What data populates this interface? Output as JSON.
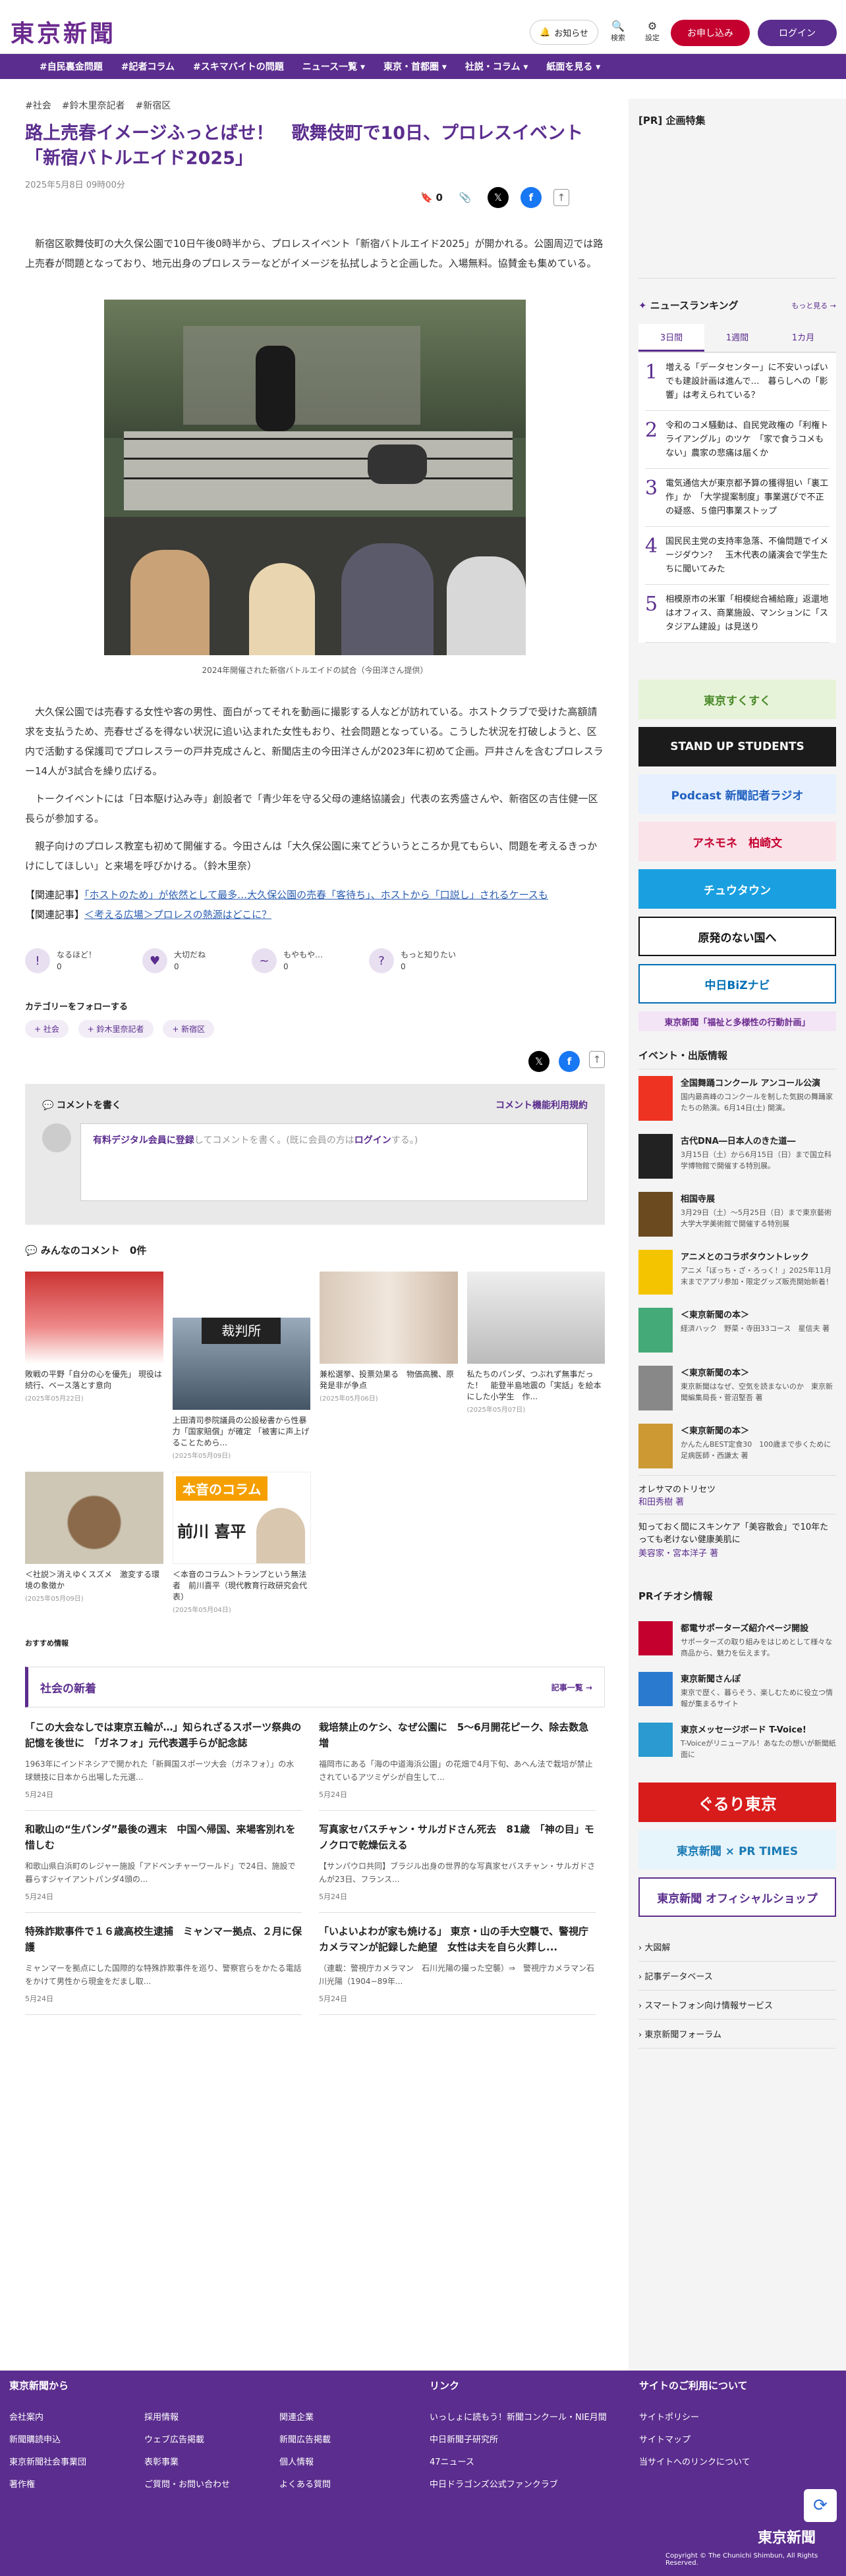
{
  "header": {
    "logo": "東京新聞",
    "notif": "お知らせ",
    "search": "検索",
    "settings": "設定",
    "register": "お申し込み",
    "login": "ログイン"
  },
  "nav": [
    "#自民裏金問題",
    "#記者コラム",
    "#スキマバイトの問題",
    "ニュース一覧 ▾",
    "東京・首都圏 ▾",
    "社説・コラム ▾",
    "紙面を見る ▾"
  ],
  "article": {
    "tags": [
      "#社会",
      "#鈴木里奈記者",
      "#新宿区"
    ],
    "title": "路上売春イメージふっとばせ！　歌舞伎町で10日、プロレスイベント「新宿バトルエイド2025」",
    "date": "2025年5月8日 09時00分",
    "bookmark_count": "0",
    "p1": "新宿区歌舞伎町の大久保公園で10日午後0時半から、プロレスイベント「新宿バトルエイド2025」が開かれる。公園周辺では路上売春が問題となっており、地元出身のプロレスラーなどがイメージを払拭しようと企画した。入場無料。協賛金も集めている。",
    "caption": "2024年開催された新宿バトルエイドの試合（今田洋さん提供）",
    "p2": "大久保公園では売春する女性や客の男性、面白がってそれを動画に撮影する人などが訪れている。ホストクラブで受けた高額請求を支払うため、売春せざるを得ない状況に追い込まれた女性もおり、社会問題となっている。こうした状況を打破しようと、区内で活動する保護司でプロレスラーの戸井克成さんと、新聞店主の今田洋さんが2023年に初めて企画。戸井さんを含むプロレスラー14人が3試合を繰り広げる。",
    "p3": "トークイベントには「日本駆け込み寺」創設者で「青少年を守る父母の連絡協議会」代表の玄秀盛さんや、新宿区の吉住健一区長らが参加する。",
    "p4": "親子向けのプロレス教室も初めて開催する。今田さんは「大久保公園に来てどういうところか見てもらい、問題を考えるきっかけにしてほしい」と来場を呼びかける。（鈴木里奈）",
    "rel_label": "【関連記事】",
    "rel1": "「ホストのため」が依然として最多…大久保公園の売春「客待ち」、ホストから「口説し」されるケースも",
    "rel2": "＜考える広場＞プロレスの熱源はどこに？"
  },
  "reactions": [
    {
      "label": "なるほど！",
      "count": "0"
    },
    {
      "label": "大切だね",
      "count": "0"
    },
    {
      "label": "もやもや…",
      "count": "0"
    },
    {
      "label": "もっと知りたい",
      "count": "0"
    }
  ],
  "follow": {
    "title": "カテゴリーをフォローする",
    "chips": [
      "+ 社会",
      "+ 鈴木里奈記者",
      "+ 新宿区"
    ]
  },
  "comment": {
    "write": "コメントを書く",
    "rules": "コメント機能利用規約",
    "pre": "有料デジタル会員に登録",
    "mid": "してコメントを書く。(既に会員の方は",
    "login": "ログイン",
    "post": "する。)",
    "all": "みんなのコメント　0件"
  },
  "thumbs": [
    {
      "t": "敗戦の平野「自分の心を優先」 現役は続行、ベース落とす意向",
      "d": "(2025年05月22日)"
    },
    {
      "t": "上田清司参院議員の公設秘書から性暴力「国家賠償」が確定 「被害に声上げることためら...",
      "d": "(2025年05月09日)"
    },
    {
      "t": "兼松選挙、投票効果る　物価高騰、原発是非が争点",
      "d": "(2025年05月06日)"
    },
    {
      "t": "私たちのパンダ、つぶれず無事だった！　能登半島地震の「実話」を絵本にした小学生　作...",
      "d": "(2025年05月07日)"
    },
    {
      "t": "＜社説＞消えゆくスズメ　激変する環境の象徴か",
      "d": "(2025年05月09日)"
    },
    {
      "t": "＜本音のコラム＞トランプという無法者　前川喜平（現代教育行政研究会代表）",
      "d": "(2025年05月04日)"
    }
  ],
  "column_name": "前川 喜平",
  "column_badge": "本音の",
  "column_badge2": "コラム",
  "recommend": "おすすめ情報",
  "shakai": {
    "head": "社会の新着",
    "more": "記事一覧 →",
    "items": [
      {
        "h": "「この大会なしでは東京五輪が…」知られざるスポーツ祭典の記憶を後世に　「ガネフォ」元代表選手らが記念誌",
        "s": "1963年にインドネシアで開かれた「新興国スポーツ大会（ガネフォ）」の水球競技に日本から出場した元選...",
        "d": "5月24日"
      },
      {
        "h": "栽培禁止のケシ、なぜ公園に　5～6月開花ピーク、除去数急増",
        "s": "福岡市にある「海の中道海浜公園」の花畑で4月下旬、あへん法で栽培が禁止されているアツミゲシが自生して...",
        "d": "5月24日"
      },
      {
        "h": "和歌山の“生パンダ”最後の週末　中国へ帰国、来場客別れを惜しむ",
        "s": "和歌山県白浜町のレジャー施設「アドベンチャーワールド」で24日、施設で暮らすジャイアントパンダ4頭の...",
        "d": "5月24日"
      },
      {
        "h": "写真家セバスチャン・サルガドさん死去　81歳　「神の目」モノクロで乾燥伝える",
        "s": "【サンパウロ共同】ブラジル出身の世界的な写真家セバスチャン・サルガドさんが23日、フランス...",
        "d": "5月24日"
      },
      {
        "h": "特殊詐欺事件で１６歳高校生逮捕　ミャンマー拠点、２月に保護",
        "s": "ミャンマーを拠点にした国際的な特殊詐欺事件を巡り、警察官らをかたる電話をかけて男性から現金をだまし取...",
        "d": "5月24日"
      },
      {
        "h": "「いよいよわが家も焼ける」 東京・山の手大空襲で、警視庁カメラマンが記録した絶望　女性は夫を自ら火葬し...",
        "s": "（連載：警視庁カメラマン　石川光陽の撮った空襲）⇒　警視庁カメラマン石川光陽（1904−89年...",
        "d": "5月24日"
      }
    ]
  },
  "sidebar": {
    "pr": "[PR] 企画特集",
    "rank_title": "ニュースランキング",
    "rank_more": "もっと見る →",
    "rank_tabs": [
      "3日間",
      "1週間",
      "1カ月"
    ],
    "rank": [
      {
        "n": "1",
        "t": "増える「データセンター」に不安いっぱいでも建設計画は進んで…　暮らしへの「影響」は考えられている？"
      },
      {
        "n": "2",
        "t": "令和のコメ騒動は、自民党政権の「利権トライアングル」のツケ　「家で食うコメもない」農家の悲痛は届くか"
      },
      {
        "n": "3",
        "t": "電気通信大が東京都予算の獲得狙い「裏工作」か　「大学提案制度」事業選びで不正の疑惑、５億円事業ストップ"
      },
      {
        "n": "4",
        "t": "国民民主党の支持率急落、不倫問題でイメージダウン？　玉木代表の議演会で学生たちに聞いてみた"
      },
      {
        "n": "5",
        "t": "相模原市の米軍「相模総合補給廠」返還地はオフィス、商業施設、マンションに「スタジアム建設」は見送り"
      }
    ],
    "banners": [
      {
        "t": "東京すくすく",
        "bg": "#e7f3d9",
        "fg": "#4a8a2a"
      },
      {
        "t": "STAND UP STUDENTS",
        "bg": "#1b1b1b",
        "fg": "#fff"
      },
      {
        "t": "Podcast 新聞記者ラジオ",
        "bg": "#e6f0ff",
        "fg": "#1f5fbf"
      },
      {
        "t": "アネモネ　柏崎文",
        "bg": "#fbe3ea",
        "fg": "#c4002f"
      },
      {
        "t": "チュウタウン",
        "bg": "#1aa0e0",
        "fg": "#fff"
      },
      {
        "t": "原発のない国へ",
        "bg": "#fff",
        "fg": "#111"
      },
      {
        "t": "中日BiZナビ",
        "bg": "#fff",
        "fg": "#006fb5"
      },
      {
        "t": "東京新聞「福祉と多様性の行動計画」",
        "bg": "#f3e4f6",
        "fg": "#6b2a8f"
      }
    ],
    "events_title": "イベント・出版情報",
    "events": [
      {
        "h": "全国舞踊コンクール アンコール公演",
        "s": "国内最高峰のコンクールを制した気鋭の舞踊家たちの熱演。6月14日(土) 開演。",
        "c": "#e32"
      },
      {
        "h": "古代DNA―日本人のきた道―",
        "s": "3月15日（土）から6月15日（日）まで国立科学博物館で開催する特別展。",
        "c": "#222"
      },
      {
        "h": "相国寺展",
        "s": "3月29日（土）～5月25日（日）まで東京藝術大学大学美術館で開催する特別展",
        "c": "#6b4a20"
      },
      {
        "h": "アニメとのコラボタウントレック",
        "s": "アニメ「ぼっち・ざ・ろっく！」2025年11月末までアプリ参加・限定グッズ販売開始新着！",
        "c": "#f5c400"
      },
      {
        "h": "＜東京新聞の本＞",
        "s": "経済ハック　野菜・寺田33コース　星信夫 著",
        "c": "#4a7"
      },
      {
        "h": "＜東京新聞の本＞",
        "s": "東京新聞はなぜ、空気を読まないのか　東京新聞編集局長・菅沼堅吾 著",
        "c": "#888"
      },
      {
        "h": "＜東京新聞の本＞",
        "s": "かんたんBEST定食30　100歳まで歩くために　足病医師・西謙太 著",
        "c": "#c93"
      }
    ],
    "book1": "オレサマのトリセツ",
    "book1b": "和田秀樹 著",
    "book2": "知っておく間にスキンケア「美容散会」で10年たっても老けない健康美肌に",
    "book2b": "美容家・宮本洋子 著",
    "pr_title": "PRイチオシ情報",
    "pr_items": [
      {
        "h": "都電サポーターズ紹介ページ開設",
        "s": "サポーターズの取り組みをはじめとして様々な商品から、魅力を伝えます。",
        "c": "#c4002f"
      },
      {
        "h": "東京新聞さんぽ",
        "s": "東京で歴く、暮らそう、楽しむために役立つ情報が集まるサイト",
        "c": "#2a7bd0"
      },
      {
        "h": "東京メッセージボード T-Voice!",
        "s": "T-Voiceがリニューアル！あなたの想いが新聞紙面に",
        "c": "#2a9ad0"
      }
    ],
    "ad1": "ぐるり東京",
    "ad2": "東京新聞 × PR TIMES",
    "ad3": "東京新聞 オフィシャルショップ",
    "links": [
      "大図解",
      "記事データベース",
      "スマートフォン向け情報サービス",
      "東京新聞フォーラム"
    ]
  },
  "footer": {
    "c1": "東京新聞から",
    "c1a": [
      "会社案内",
      "新聞購読申込",
      "東京新聞社会事業団",
      "著作権"
    ],
    "c1b": [
      "採用情報",
      "ウェブ広告掲載",
      "表彰事業",
      "ご質問・お問い合わせ"
    ],
    "c1c": [
      "関連企業",
      "新聞広告掲載",
      "個人情報",
      "よくある質問"
    ],
    "c2": "リンク",
    "c2a": [
      "いっしょに読もう！新聞コンクール・NIE月間",
      "中日新聞子研究所",
      "47ニュース",
      "中日ドラゴンズ公式ファンクラブ"
    ],
    "c3": "サイトのご利用について",
    "c3a": [
      "サイトポリシー",
      "サイトマップ",
      "当サイトへのリンクについて"
    ],
    "logo": "東京新聞",
    "copy": "Copyright © The Chunichi Shimbun, All Rights Reserved."
  }
}
